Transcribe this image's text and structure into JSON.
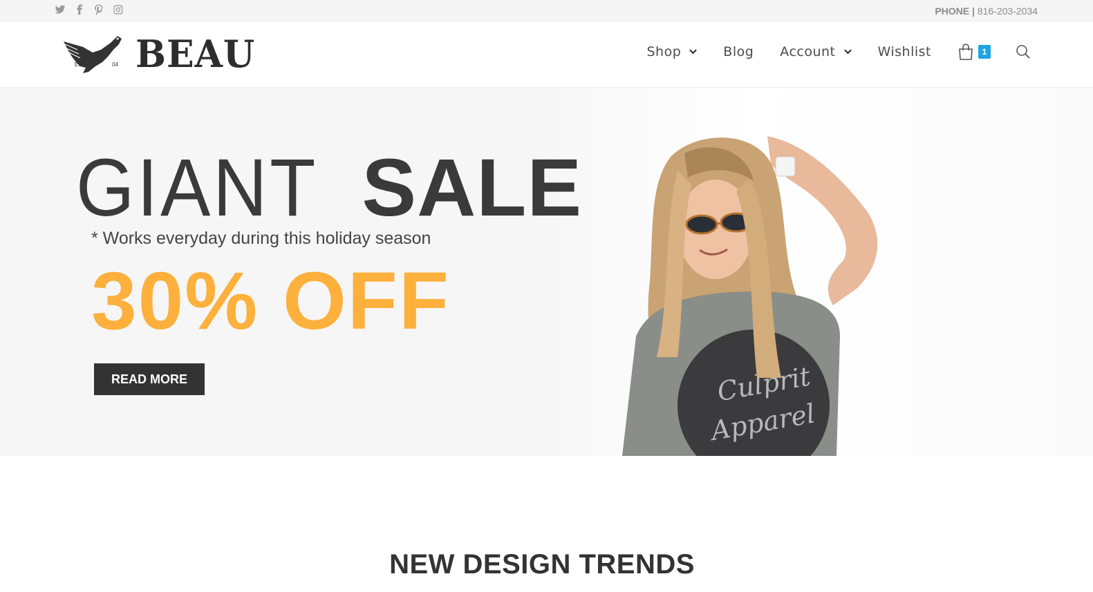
{
  "topbar": {
    "social_icons": [
      "twitter-icon",
      "facebook-icon",
      "pinterest-icon",
      "instagram-icon"
    ],
    "phone_label": "PHONE |",
    "phone_number": "816-203-2034"
  },
  "header": {
    "logo_text": "BEAU",
    "logo_badge_left": "EST",
    "logo_badge_right": "04",
    "nav": {
      "shop": "Shop",
      "blog": "Blog",
      "account": "Account",
      "wishlist": "Wishlist"
    },
    "cart_count": "1",
    "cart_icon": "shopping-bag-icon",
    "search_icon": "search-icon"
  },
  "hero": {
    "title_light": "GIANT",
    "title_bold": "SALE",
    "subtitle": "* Works everyday during this holiday season",
    "discount": "30% OFF",
    "button_label": "READ MORE",
    "shirt_text_line1": "Culprit",
    "shirt_text_line2": "Apparel"
  },
  "section": {
    "title": "NEW DESIGN TRENDS"
  },
  "colors": {
    "accent_orange": "#fdb03b",
    "badge_blue": "#1fa5e0",
    "button_dark": "#333333"
  }
}
